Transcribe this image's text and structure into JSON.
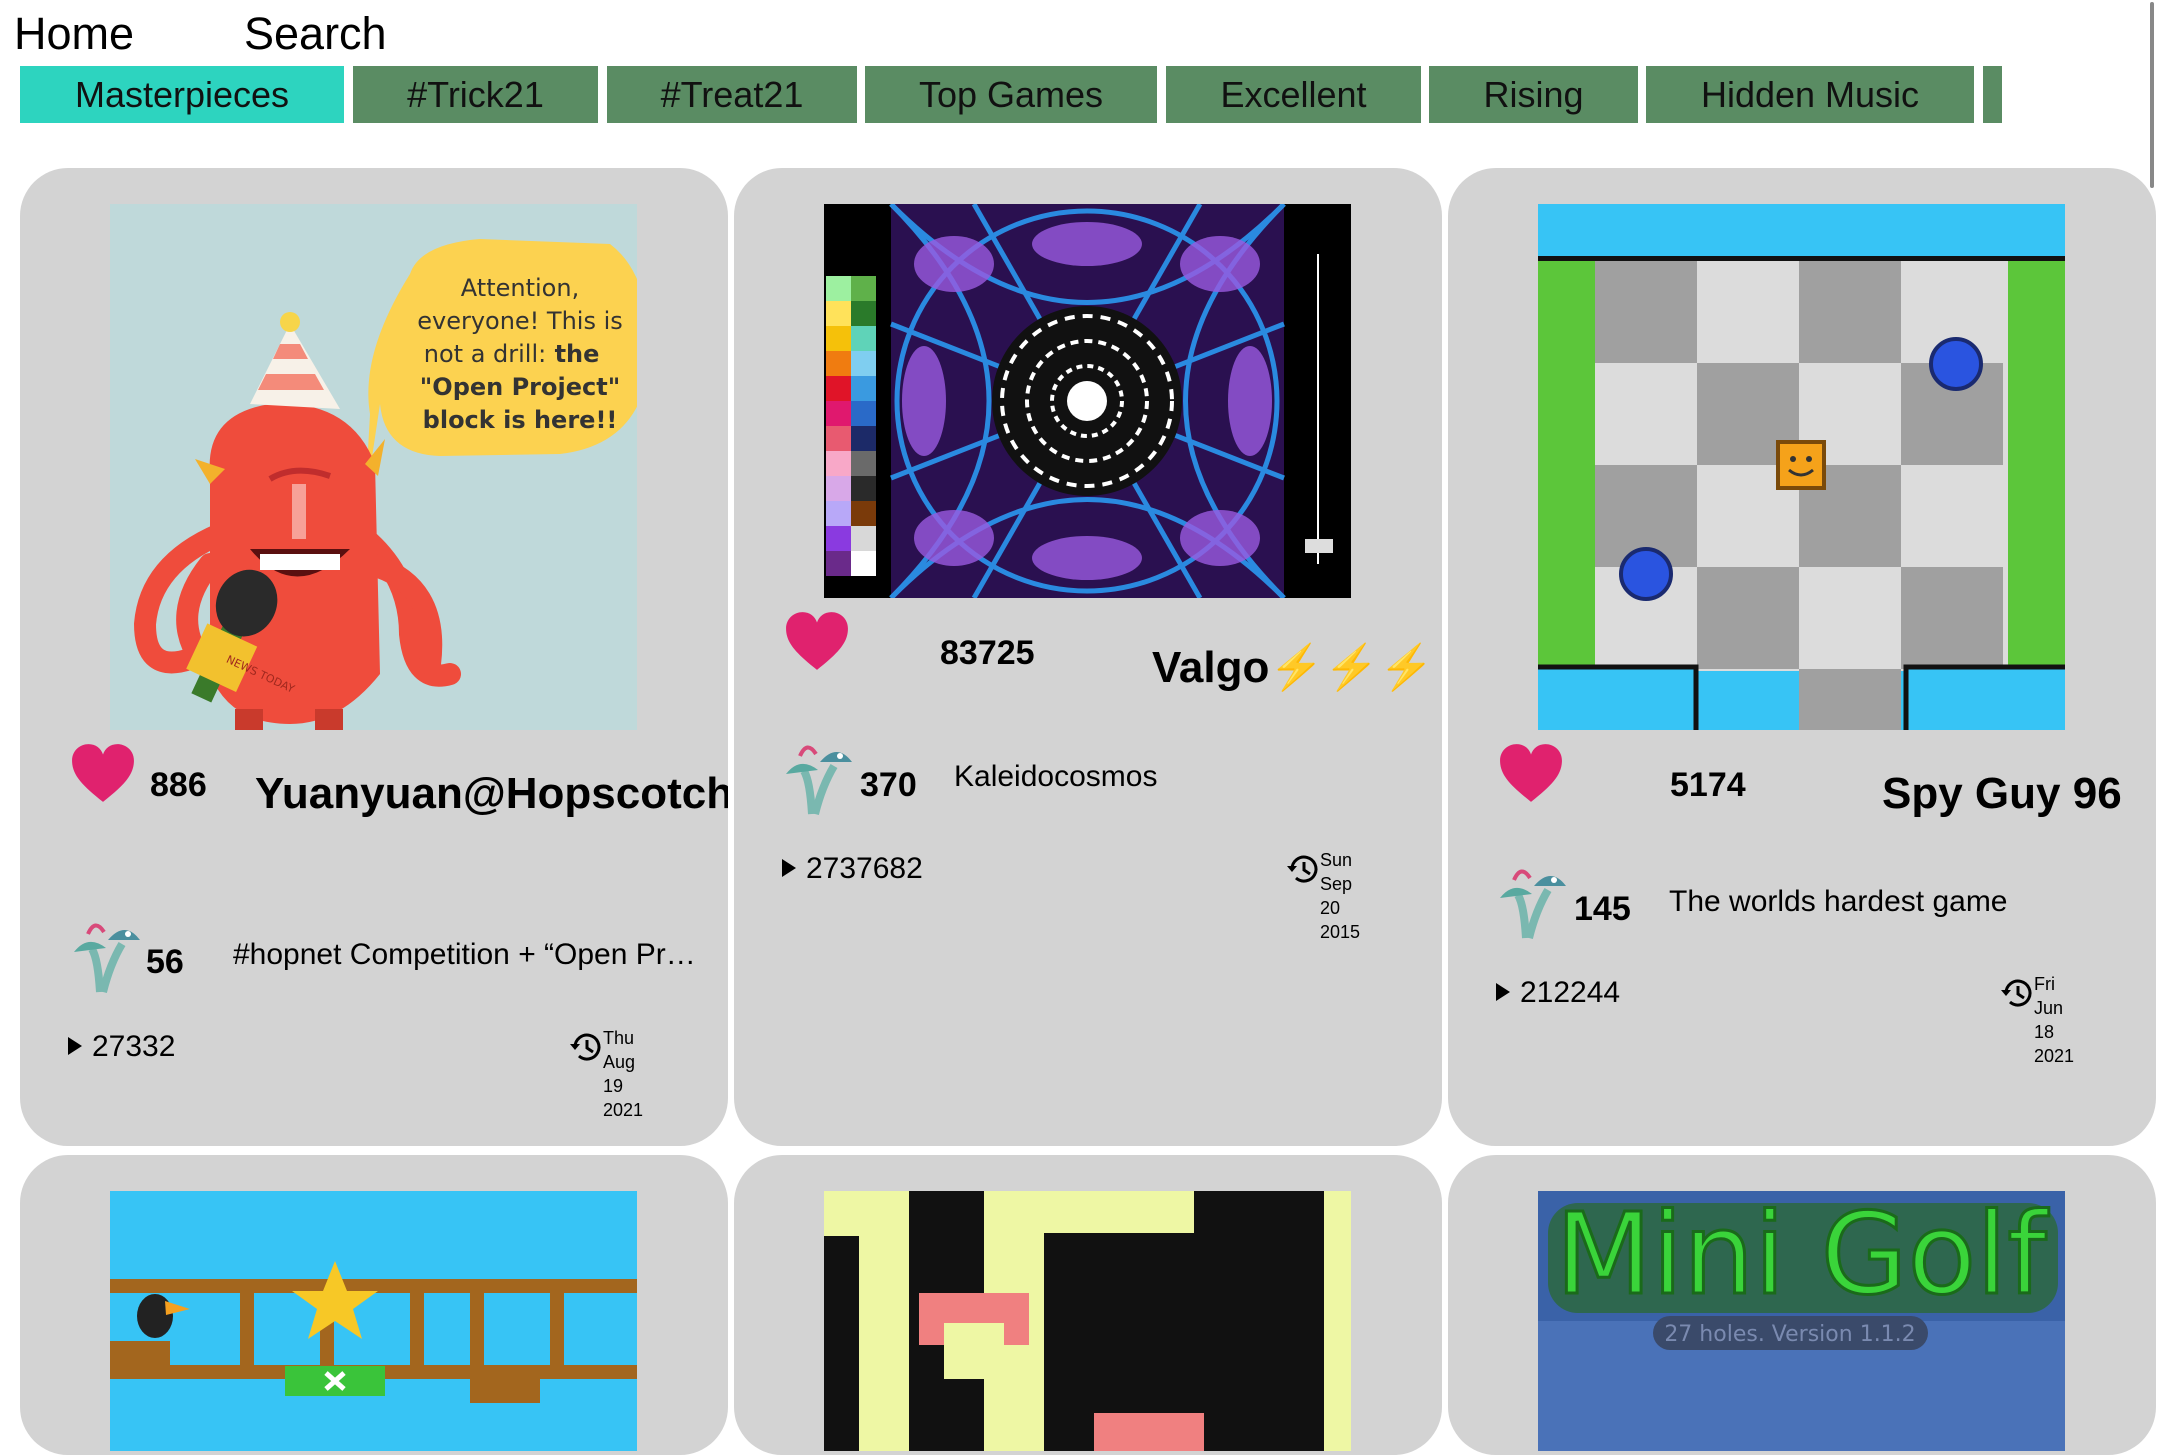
{
  "nav": {
    "home": "Home",
    "search": "Search"
  },
  "tabs": [
    "Masterpieces",
    "#Trick21",
    "#Treat21",
    "Top Games",
    "Excellent",
    "Rising",
    "Hidden Music",
    ""
  ],
  "cards": [
    {
      "likes": "886",
      "author": "Yuanyuan@Hopscotch",
      "remixes": "56",
      "title": "#hopnet Competition + “Open Pr…",
      "plays": "27332",
      "date": [
        "Thu",
        "Aug",
        "19",
        "2021"
      ],
      "bubble": {
        "line1": "Attention,",
        "line2": "everyone! This is",
        "line3": "not a drill: ",
        "line3b": "the",
        "line4": "\"Open Project\"",
        "line5": "block is here!!"
      },
      "mic_text": "NEWS TODAY"
    },
    {
      "likes": "83725",
      "author": "Valgo⚡⚡⚡",
      "remixes": "370",
      "title": "Kaleidocosmos",
      "plays": "2737682",
      "date": [
        "Sun",
        "Sep",
        "20",
        "2015"
      ]
    },
    {
      "likes": "5174",
      "author": "Spy Guy 96",
      "remixes": "145",
      "title": "The worlds hardest game",
      "plays": "212244",
      "date": [
        "Fri",
        "Jun",
        "18",
        "2021"
      ]
    },
    {
      "id_hint": "platformer"
    },
    {
      "id_hint": "maze"
    },
    {
      "thumb_title": "Mini Golf",
      "thumb_subtitle": "27 holes. Version 1.1.2"
    }
  ],
  "colors": {
    "tab_bg": "#5a8c63",
    "tab_active": "#2dd4bf",
    "card_bg": "#d3d3d3",
    "heart": "#e0226e"
  },
  "icons": {
    "heart": "heart-icon",
    "remix": "remix-mushroom-icon",
    "play": "play-icon",
    "history": "history-clock-icon"
  }
}
